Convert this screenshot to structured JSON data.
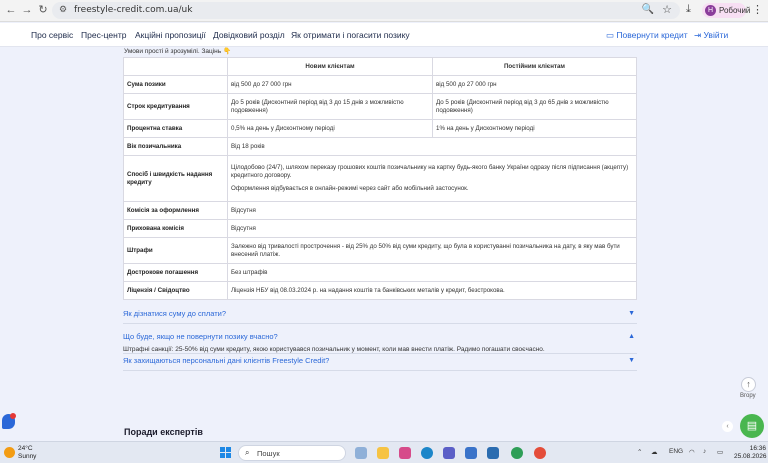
{
  "browser": {
    "url": "freestyle-credit.com.ua/uk",
    "profile_initial": "Н",
    "profile_name": "Робочий"
  },
  "header": {
    "nav": [
      "Про сервіс",
      "Прес-центр",
      "Акційні пропозиції",
      "Довідковий розділ",
      "Як отримати і погасити позику"
    ],
    "return_credit": "Повернути кредит",
    "login": "Увійти"
  },
  "intro_text": "Умови прості й зрозумілі. Зацінь 👇",
  "table": {
    "headers": [
      "",
      "Новим клієнтам",
      "Постійним клієнтам"
    ],
    "rows": [
      {
        "label": "Сума позики",
        "new": "від 500 до 27 000 грн",
        "regular": "від 500 до 27 000 грн"
      },
      {
        "label": "Строк кредитування",
        "new": "До 5 років (Дисконтний період від 3 до 15 днів з можливістю подовження)",
        "regular": "До 5 років (Дисконтний період від 3 до 65 днів з можливістю подовження)"
      },
      {
        "label": "Процентна ставка",
        "new": "0,5% на день у Дисконтному періоді",
        "regular": "1% на день у Дисконтному періоді"
      },
      {
        "label": "Вік позичальника",
        "value": "Від 18 років"
      },
      {
        "label": "Спосіб і швидкість надання кредиту",
        "value": "Цілодобово (24/7), шляхом переказу грошових коштів позичальнику на картку будь-якого банку України одразу після підписання (акцепту) кредитного договору.",
        "value2": "Оформлення відбувається в онлайн-режимі через сайт або мобільний застосунок."
      },
      {
        "label": "Комісія за оформлення",
        "value": "Відсутня"
      },
      {
        "label": "Прихована комісія",
        "value": "Відсутня"
      },
      {
        "label": "Штрафи",
        "value": "Залежно від тривалості прострочення - від 25% до 50% від суми кредиту, що була в користуванні позичальника на дату, в яку мав бути внесений платіж."
      },
      {
        "label": "Дострокове погашення",
        "value": "Без штрафів"
      },
      {
        "label": "Ліцензія / Свідоцтво",
        "value": "Ліцензія НБУ від 08.03.2024 р. на надання коштів та банківських металів у кредит, безстрокова."
      }
    ]
  },
  "faq": [
    {
      "question": "Як дізнатися суму до сплати?",
      "open": false
    },
    {
      "question": "Що буде, якщо не повернути позику вчасно?",
      "open": true,
      "answer": "Штрафні санкції: 25-50% від суми кредиту, якою користувався позичальник у момент, коли мав внести платіж. Радимо погашати своєчасно."
    },
    {
      "question": "Як захищаються персональні дані клієнтів Freestyle Credit?",
      "open": false
    }
  ],
  "scroll_up_label": "Вгору",
  "tips_title": "Поради експертів",
  "taskbar": {
    "weather_temp": "24°C",
    "weather_desc": "Sunny",
    "search_placeholder": "Пошук",
    "lang": "ENG",
    "time": "16:36",
    "date": "25.08.2026"
  },
  "colors": {
    "accent": "#2b68d8",
    "chat": "#49b64f",
    "page_bg": "#eef1fb"
  }
}
